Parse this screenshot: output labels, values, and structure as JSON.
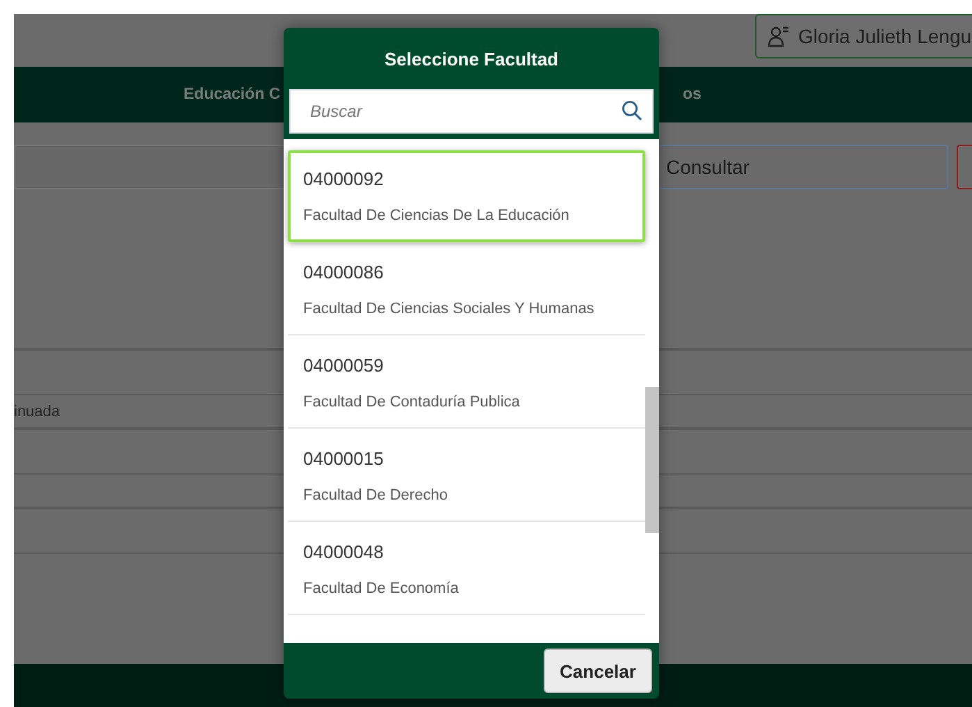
{
  "user_button": {
    "label": "Gloria Julieth Lengu"
  },
  "nav": {
    "items": [
      {
        "label": "Educación C"
      },
      {
        "label": "os"
      }
    ]
  },
  "query_bar": {
    "button": "Consultar"
  },
  "table": {
    "rows": [
      {
        "cell": ""
      },
      {
        "cell": "inuada"
      },
      {
        "cell": ""
      },
      {
        "cell": ""
      },
      {
        "cell": ""
      },
      {
        "cell": ""
      }
    ]
  },
  "dialog": {
    "title": "Seleccione Facultad",
    "search": {
      "placeholder": "Buscar"
    },
    "items": [
      {
        "code": "04000092",
        "name": "Facultad De Ciencias De La Educación",
        "selected": true
      },
      {
        "code": "04000086",
        "name": "Facultad De Ciencias Sociales Y Humanas",
        "selected": false
      },
      {
        "code": "04000059",
        "name": "Facultad De Contaduría Publica",
        "selected": false
      },
      {
        "code": "04000015",
        "name": "Facultad De Derecho",
        "selected": false
      },
      {
        "code": "04000048",
        "name": "Facultad De Economía",
        "selected": false
      }
    ],
    "cancel": "Cancelar"
  }
}
